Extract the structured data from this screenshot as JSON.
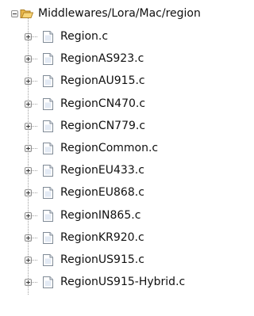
{
  "tree": {
    "root": {
      "label": "Middlewares/Lora/Mac/region",
      "icon": "folder-open-icon",
      "expanded": true
    },
    "children": [
      {
        "label": "Region.c",
        "icon": "c-file-icon",
        "expanded": false
      },
      {
        "label": "RegionAS923.c",
        "icon": "c-file-icon",
        "expanded": false
      },
      {
        "label": "RegionAU915.c",
        "icon": "c-file-icon",
        "expanded": false
      },
      {
        "label": "RegionCN470.c",
        "icon": "c-file-icon",
        "expanded": false
      },
      {
        "label": "RegionCN779.c",
        "icon": "c-file-icon",
        "expanded": false
      },
      {
        "label": "RegionCommon.c",
        "icon": "c-file-icon",
        "expanded": false
      },
      {
        "label": "RegionEU433.c",
        "icon": "c-file-icon",
        "expanded": false
      },
      {
        "label": "RegionEU868.c",
        "icon": "c-file-icon",
        "expanded": false
      },
      {
        "label": "RegionIN865.c",
        "icon": "c-file-icon",
        "expanded": false
      },
      {
        "label": "RegionKR920.c",
        "icon": "c-file-icon",
        "expanded": false
      },
      {
        "label": "RegionUS915.c",
        "icon": "c-file-icon",
        "expanded": false
      },
      {
        "label": "RegionUS915-Hybrid.c",
        "icon": "c-file-icon",
        "expanded": false
      }
    ]
  }
}
